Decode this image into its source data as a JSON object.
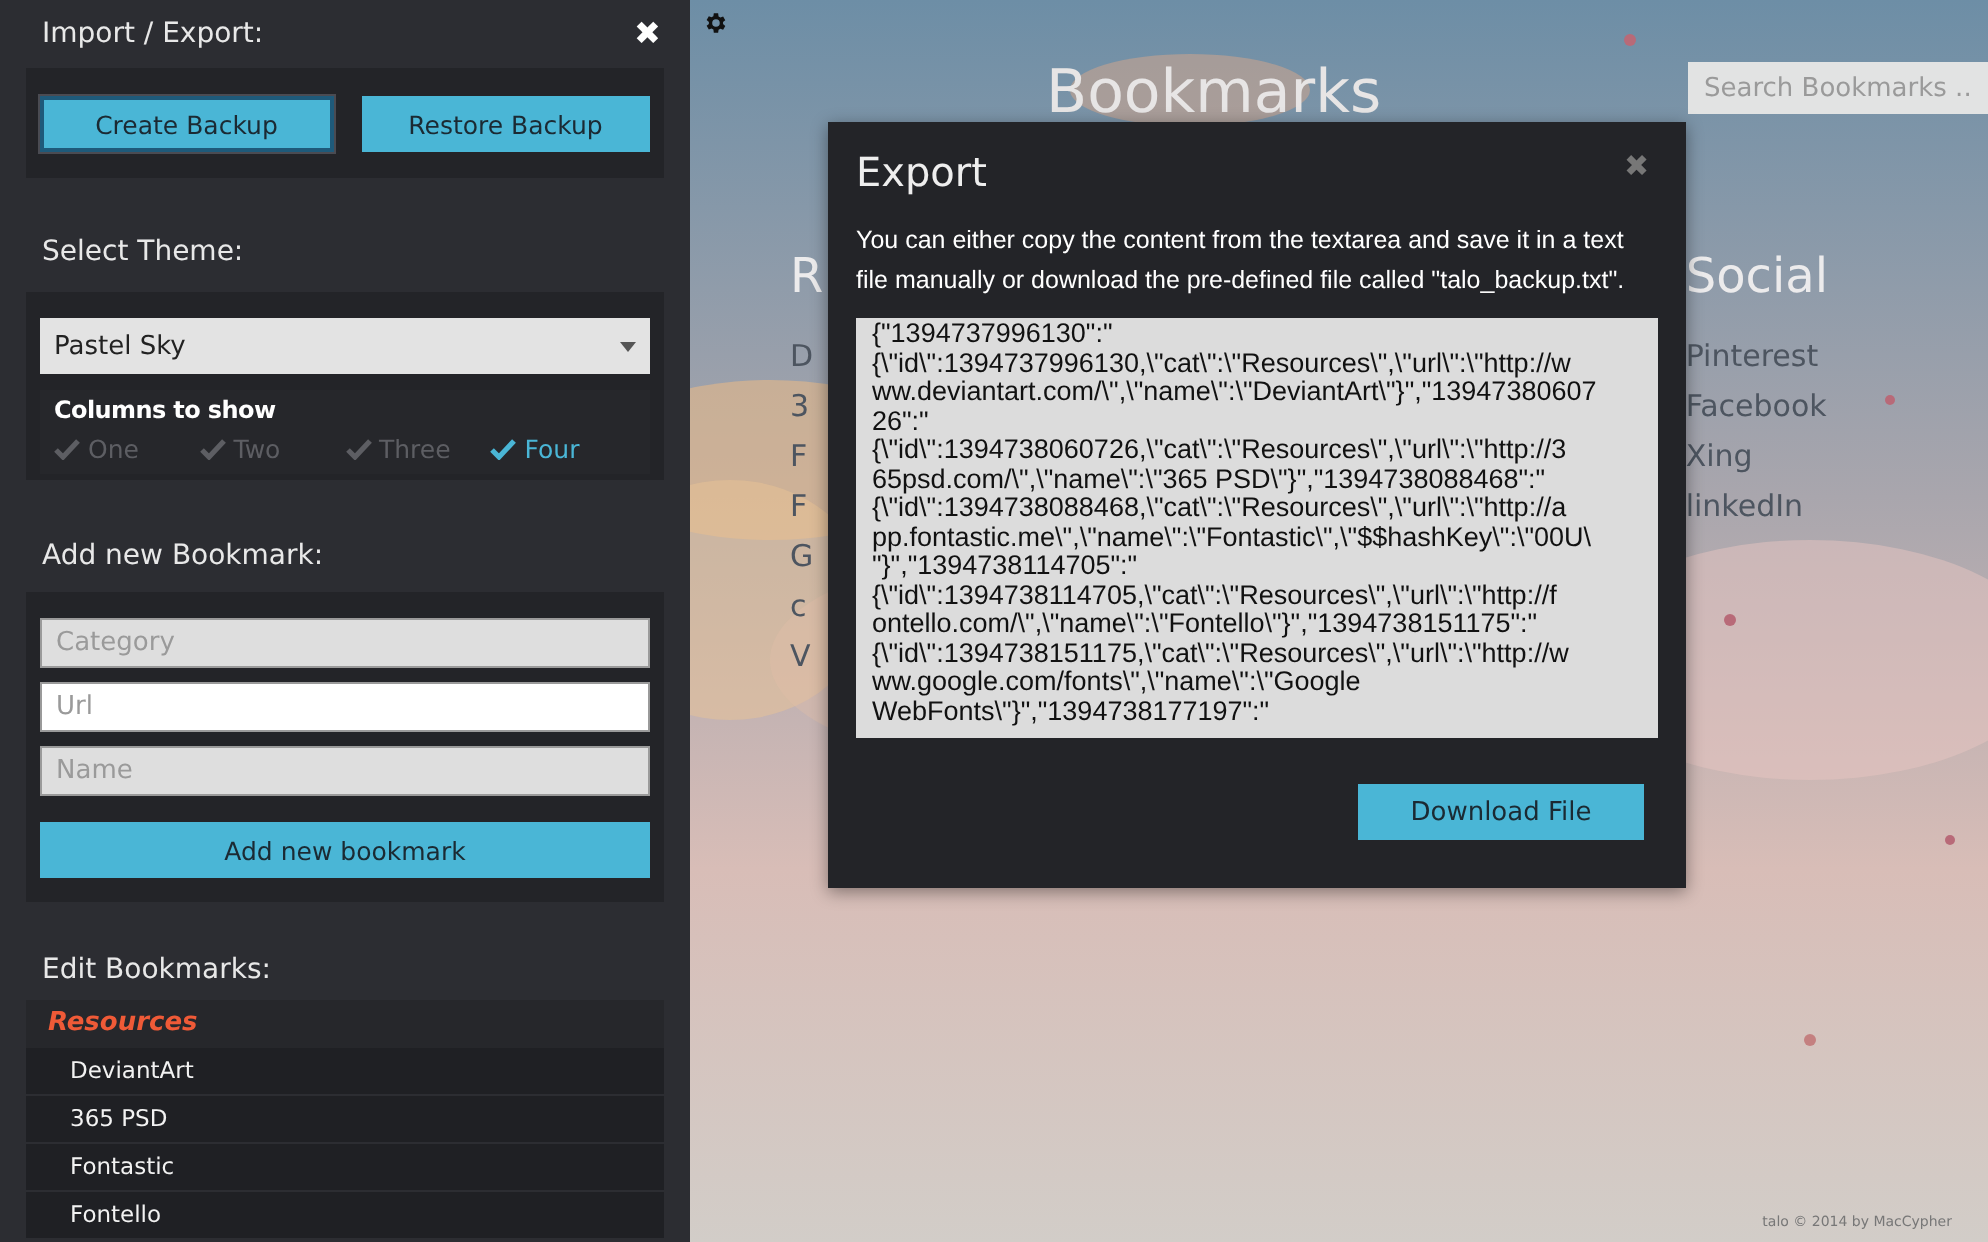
{
  "sidebar": {
    "close": "✖",
    "import_export": {
      "title": "Import / Export:",
      "buttons": [
        {
          "label": "Create Backup",
          "selected": true
        },
        {
          "label": "Restore Backup",
          "selected": false
        }
      ]
    },
    "theme": {
      "title": "Select Theme:",
      "select_value": "Pastel Sky",
      "columns_title": "Columns to show",
      "columns": [
        {
          "label": "One",
          "checked": false
        },
        {
          "label": "Two",
          "checked": false
        },
        {
          "label": "Three",
          "checked": false
        },
        {
          "label": "Four",
          "checked": true
        }
      ]
    },
    "add_bookmark": {
      "title": "Add new Bookmark:",
      "fields": [
        {
          "placeholder": "Category",
          "focused": false
        },
        {
          "placeholder": "Url",
          "focused": true
        },
        {
          "placeholder": "Name",
          "focused": false
        }
      ],
      "button": "Add new bookmark"
    },
    "edit_bookmarks": {
      "title": "Edit Bookmarks:",
      "category": "Resources",
      "items": [
        "DeviantArt",
        "365 PSD",
        "Fontastic",
        "Fontello"
      ]
    }
  },
  "main": {
    "title": "Bookmarks",
    "search": {
      "placeholder": "Search Bookmarks ..."
    },
    "columns": [
      {
        "heading": "R",
        "links": [
          "D",
          "3",
          "F",
          "F",
          "G",
          "c",
          "V"
        ]
      },
      {
        "heading": "Social",
        "links": [
          "Pinterest",
          "Facebook",
          "Xing",
          "linkedIn"
        ]
      }
    ],
    "footer": "talo © 2014 by MacCypher"
  },
  "modal": {
    "title": "Export",
    "close": "✖",
    "description": "You can either copy the content from the textarea and save it in a text file manually or download the pre-defined file called \"talo_backup.txt\".",
    "textarea_lines": [
      "{\"1394737996130\":\"",
      "{\\\"id\\\":1394737996130,\\\"cat\\\":\\\"Resources\\\",\\\"url\\\":\\\"http://w",
      "ww.deviantart.com/\\\",\\\"name\\\":\\\"DeviantArt\\\"}\",\"13947380607",
      "26\":\"",
      "{\\\"id\\\":1394738060726,\\\"cat\\\":\\\"Resources\\\",\\\"url\\\":\\\"http://3",
      "65psd.com/\\\",\\\"name\\\":\\\"365 PSD\\\"}\",\"1394738088468\":\"",
      "{\\\"id\\\":1394738088468,\\\"cat\\\":\\\"Resources\\\",\\\"url\\\":\\\"http://a",
      "pp.fontastic.me\\\",\\\"name\\\":\\\"Fontastic\\\",\\\"$$hashKey\\\":\\\"00U\\",
      "\"}\",\"1394738114705\":\"",
      "{\\\"id\\\":1394738114705,\\\"cat\\\":\\\"Resources\\\",\\\"url\\\":\\\"http://f",
      "ontello.com/\\\",\\\"name\\\":\\\"Fontello\\\"}\",\"1394738151175\":\"",
      "{\\\"id\\\":1394738151175,\\\"cat\\\":\\\"Resources\\\",\\\"url\\\":\\\"http://w",
      "ww.google.com/fonts\\\",\\\"name\\\":\\\"Google",
      "WebFonts\\\"}\",\"1394738177197\":\""
    ],
    "button": "Download File"
  }
}
